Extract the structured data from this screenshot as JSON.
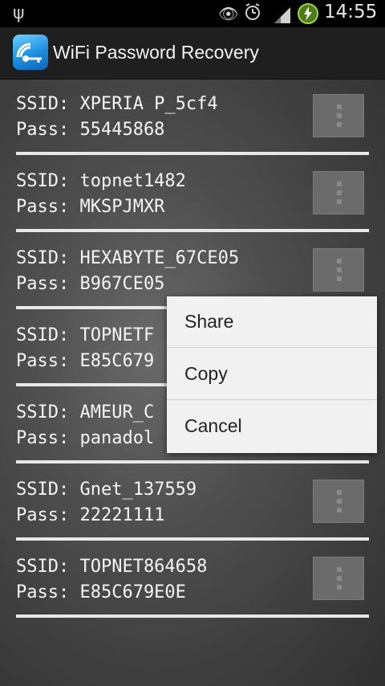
{
  "status_bar": {
    "time": "14:55",
    "icons": [
      "usb-icon",
      "eye-icon",
      "alarm-icon",
      "signal-icon",
      "battery-charging-icon"
    ]
  },
  "action_bar": {
    "title": "WiFi Password Recovery",
    "icon": "wifi-key-icon"
  },
  "networks": [
    {
      "ssid_label": "SSID: XPERIA P_5cf4",
      "pass_label": "Pass: 55445868"
    },
    {
      "ssid_label": "SSID: topnet1482",
      "pass_label": "Pass: MKSPJMXR"
    },
    {
      "ssid_label": "SSID: HEXABYTE_67CE05",
      "pass_label": "Pass: B967CE05"
    },
    {
      "ssid_label": "SSID: TOPNETF",
      "pass_label": "Pass: E85C679"
    },
    {
      "ssid_label": "SSID: AMEUR_C",
      "pass_label": "Pass: panadol"
    },
    {
      "ssid_label": "SSID: Gnet_137559",
      "pass_label": "Pass: 22221111"
    },
    {
      "ssid_label": "SSID: TOPNET864658",
      "pass_label": "Pass: E85C679E0E"
    }
  ],
  "popup_menu": {
    "items": [
      "Share",
      "Copy",
      "Cancel"
    ]
  },
  "colors": {
    "status_bar_bg": "#000000",
    "action_bar_bg": "#1f1f1f",
    "text": "#f4f4f4",
    "popup_bg": "#f1f1f1"
  }
}
